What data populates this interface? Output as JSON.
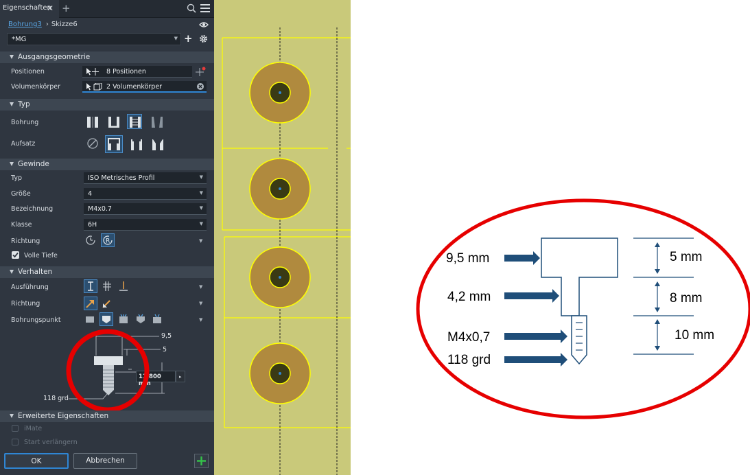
{
  "panel": {
    "tab_title": "Eigenschaften",
    "tab_close": "✕",
    "tab_add": "+",
    "breadcrumb": {
      "link": "Bohrung3",
      "separator": "›",
      "current": "Skizze6"
    },
    "preset": {
      "value": "*MG",
      "add": "+"
    },
    "sections": {
      "ausgangsgeometrie": "Ausgangsgeometrie",
      "typ": "Typ",
      "gewinde": "Gewinde",
      "verhalten": "Verhalten",
      "erweitert": "Erweiterte Eigenschaften"
    },
    "ausgangsgeometrie": {
      "positionen_label": "Positionen",
      "positionen_value": "8 Positionen",
      "volumen_label": "Volumenkörper",
      "volumen_value": "2 Volumenkörper"
    },
    "typ": {
      "bohrung_label": "Bohrung",
      "aufsatz_label": "Aufsatz"
    },
    "gewinde": {
      "typ_label": "Typ",
      "typ_value": "ISO Metrisches Profil",
      "groesse_label": "Größe",
      "groesse_value": "4",
      "bezeichnung_label": "Bezeichnung",
      "bezeichnung_value": "M4x0.7",
      "klasse_label": "Klasse",
      "klasse_value": "6H",
      "richtung_label": "Richtung",
      "volle_tiefe_label": "Volle Tiefe"
    },
    "verhalten": {
      "ausfuehrung_label": "Ausführung",
      "richtung_label": "Richtung",
      "bohrungspunkt_label": "Bohrungspunkt"
    },
    "preview": {
      "dim_top": "9,5",
      "dim_depth": "5",
      "dim_input": "11.800 mm",
      "angle": "118 grd"
    },
    "erweitert": {
      "imate": "iMate",
      "start_verlaengern": "Start verlängern"
    },
    "buttons": {
      "ok": "OK",
      "cancel": "Abbrechen",
      "plus": "+"
    }
  },
  "annotation": {
    "dia_head": "9,5 mm",
    "dia_shank": "4,2 mm",
    "thread": "M4x0,7",
    "angle": "118 grd",
    "depth_head": "5 mm",
    "depth_shank": "8 mm",
    "depth_thread": "10 mm"
  },
  "colors": {
    "panel_bg": "#2f3640",
    "accent_blue": "#2f86d4",
    "cad_bg": "#c9c97a",
    "hole_fill": "#b08a3e",
    "highlight_red": "#e60000",
    "arrow_fill": "#1f4e79"
  }
}
